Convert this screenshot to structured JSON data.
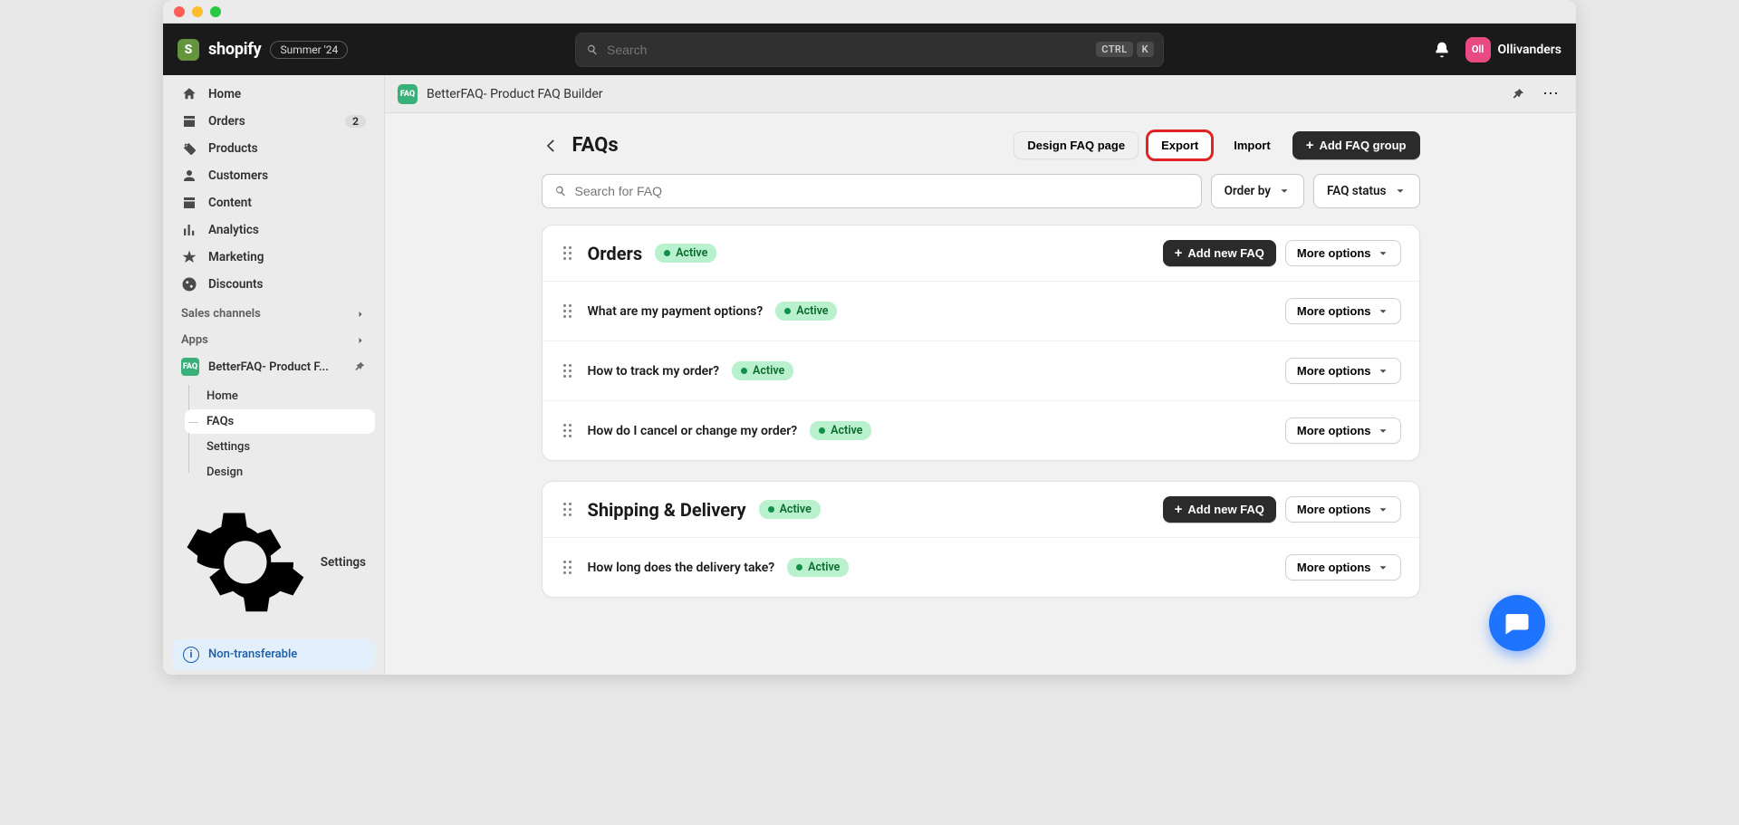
{
  "top": {
    "brand_initial": "S",
    "brand": "shopify",
    "badge": "Summer '24",
    "search_placeholder": "Search",
    "kbd1": "CTRL",
    "kbd2": "K",
    "avatar_initials": "Oll",
    "username": "Ollivanders"
  },
  "sidebar": {
    "items": [
      {
        "label": "Home"
      },
      {
        "label": "Orders",
        "badge": "2"
      },
      {
        "label": "Products"
      },
      {
        "label": "Customers"
      },
      {
        "label": "Content"
      },
      {
        "label": "Analytics"
      },
      {
        "label": "Marketing"
      },
      {
        "label": "Discounts"
      }
    ],
    "section_sales": "Sales channels",
    "section_apps": "Apps",
    "app_item": "BetterFAQ- Product F...",
    "app_sub": [
      {
        "label": "Home"
      },
      {
        "label": "FAQs",
        "current": true
      },
      {
        "label": "Settings"
      },
      {
        "label": "Design"
      }
    ],
    "settings": "Settings",
    "non_transferable": "Non-transferable"
  },
  "context": {
    "app_icon_text": "FAQ",
    "title": "BetterFAQ- Product FAQ Builder"
  },
  "page": {
    "title": "FAQs",
    "design_btn": "Design FAQ page",
    "export_btn": "Export",
    "import_btn": "Import",
    "add_group_btn": "Add FAQ group",
    "search_placeholder": "Search for FAQ",
    "order_by": "Order by",
    "faq_status": "FAQ status",
    "status_active": "Active",
    "add_new_faq": "Add new FAQ",
    "more_options": "More options",
    "groups": [
      {
        "title": "Orders",
        "faqs": [
          {
            "q": "What are my payment options?"
          },
          {
            "q": "How to track my order?"
          },
          {
            "q": "How do I cancel or change my order?"
          }
        ]
      },
      {
        "title": "Shipping & Delivery",
        "faqs": [
          {
            "q": "How long does the delivery take?"
          }
        ]
      }
    ]
  }
}
